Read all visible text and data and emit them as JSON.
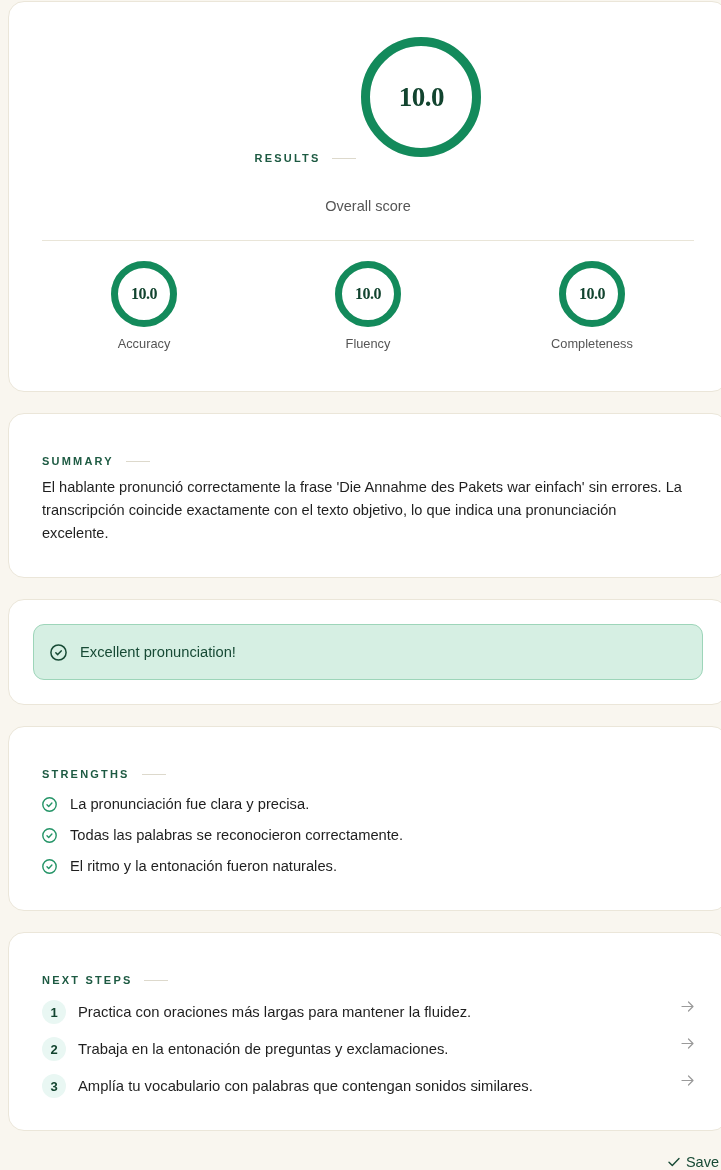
{
  "results": {
    "heading": "RESULTS",
    "overall": {
      "score": "10.0",
      "level": 1,
      "label": "Overall score"
    },
    "metrics": [
      {
        "score": "10.0",
        "level": 1,
        "label": "Accuracy"
      },
      {
        "score": "10.0",
        "level": 1,
        "label": "Fluency"
      },
      {
        "score": "10.0",
        "level": 1,
        "label": "Completeness"
      }
    ]
  },
  "summary": {
    "heading": "SUMMARY",
    "text": "El hablante pronunció correctamente la frase 'Die Annahme des Pakets war einfach' sin errores. La transcripción coincide exactamente con el texto objetivo, lo que indica una pronunciación excelente."
  },
  "feedback_banner": {
    "text": "Excellent pronunciation!"
  },
  "strengths": {
    "heading": "STRENGTHS",
    "items": [
      "La pronunciación fue clara y precisa.",
      "Todas las palabras se reconocieron correctamente.",
      "El ritmo y la entonación fueron naturales."
    ]
  },
  "next_steps": {
    "heading": "NEXT STEPS",
    "items": [
      {
        "number": "1",
        "text": "Practica con oraciones más largas para mantener la fluidez."
      },
      {
        "number": "2",
        "text": "Trabaja en la entonación de preguntas y exclamaciones."
      },
      {
        "number": "3",
        "text": "Amplía tu vocabulario con palabras que contengan sonidos similares."
      }
    ]
  },
  "status": {
    "text": "Save"
  }
}
